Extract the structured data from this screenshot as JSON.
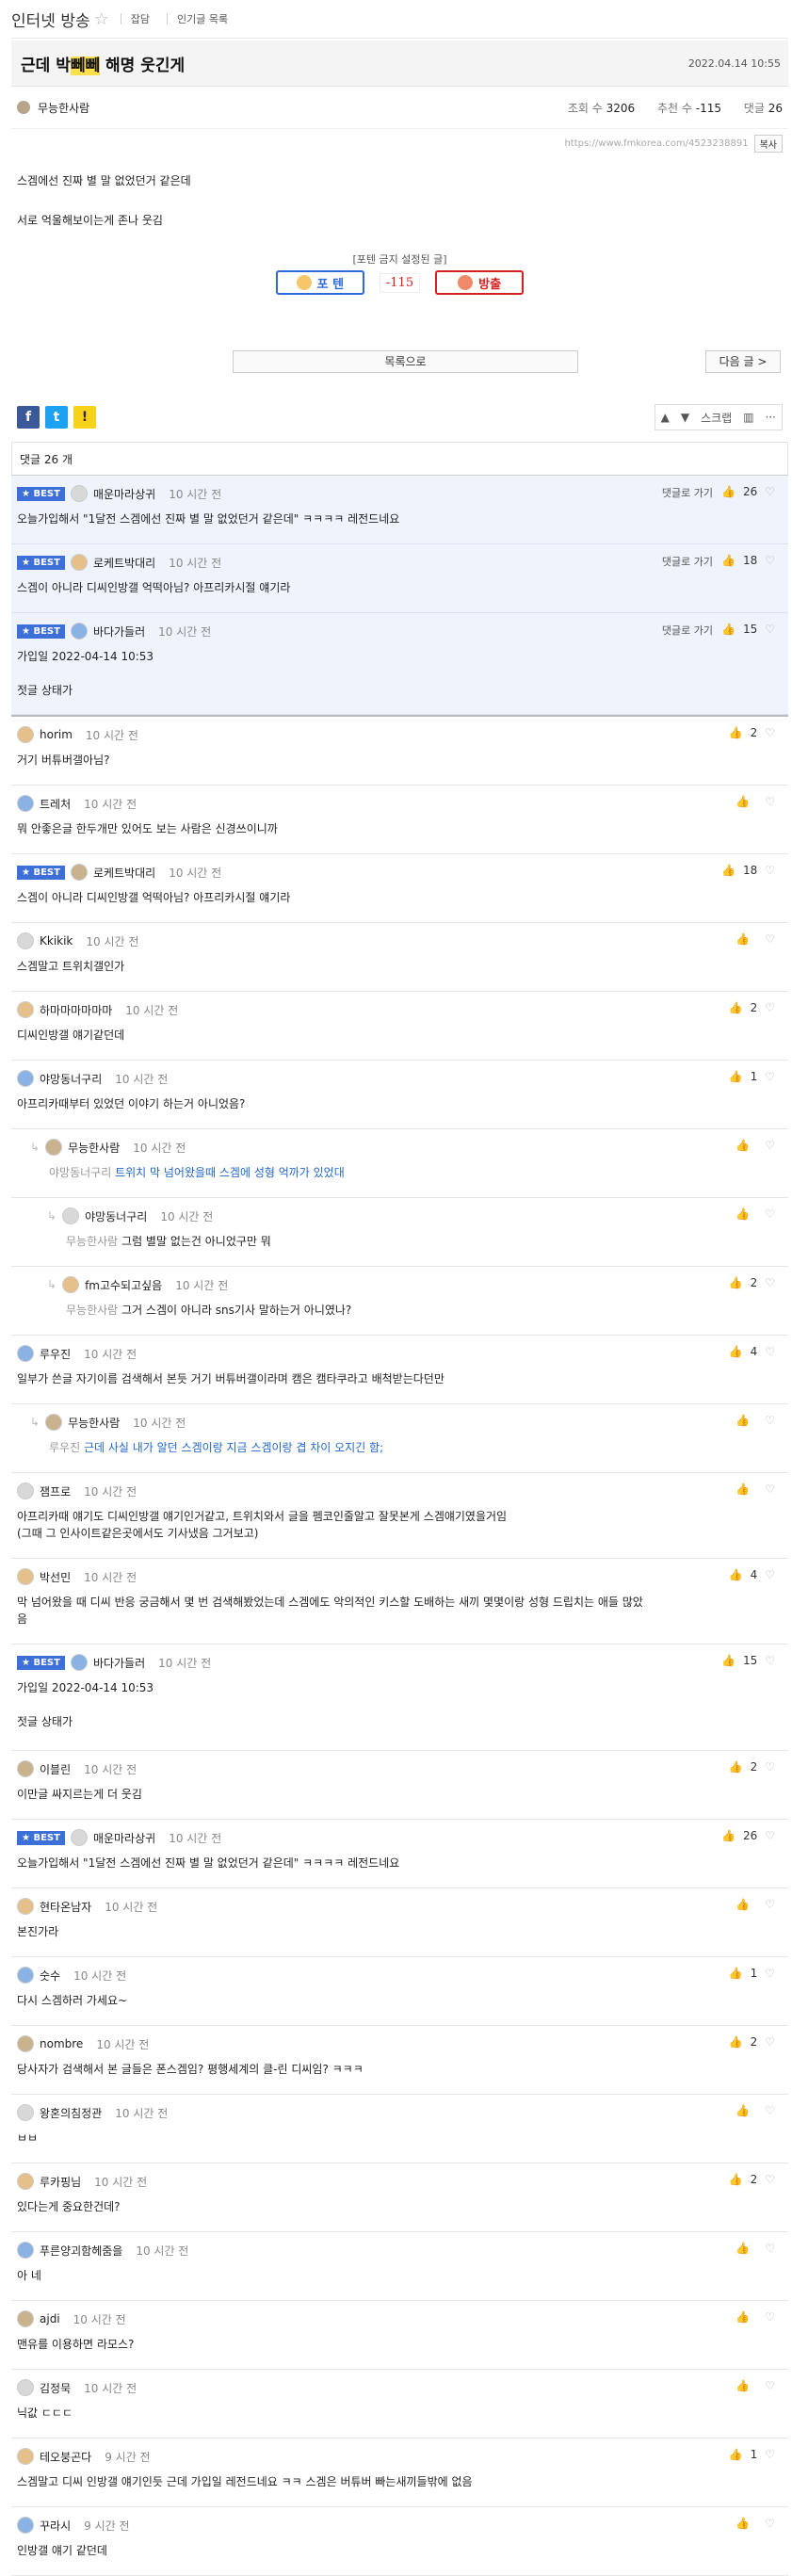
{
  "board": {
    "title": "인터넷 방송",
    "star": "☆",
    "links": [
      "잡담",
      "인기글 목록"
    ]
  },
  "post": {
    "title_prefix": "근데 박",
    "title_highlight": "뻬뻬",
    "title_suffix": " 해명 웃긴게",
    "date": "2022.04.14 10:55",
    "author": "무능한사람",
    "views_label": "조회 수",
    "views": "3206",
    "votes_label": "추천 수",
    "votes": "-115",
    "comments_label": "댓글",
    "comments": "26",
    "url": "https://www.fmkorea.com/4523238891",
    "copy": "복사",
    "body": [
      "스겜에선 진짜 별 말 없었던거 같은데",
      "서로 억울해보이는게 존나 웃김"
    ],
    "vote_caption": "[포텐 금지 설정된 글]",
    "vote_up": "포 텐",
    "vote_count": "-115",
    "vote_down": "방출",
    "list_btn": "목록으로",
    "next_btn": "다음 글 >",
    "share": {
      "fb": "f",
      "tw": "t",
      "kk": "!"
    },
    "tools": {
      "up": "▲",
      "down": "▼",
      "scrap": "스크랩",
      "stat": "▥",
      "more": "···"
    },
    "comment_count": "댓글 26 개"
  },
  "best_comments": [
    {
      "badge": "★ BEST",
      "nick": "매운마라상귀",
      "ago": "10 시간 전",
      "goto": "댓글로 가기",
      "likes": "26",
      "text": "오늘가입해서 \"1달전 스겜에선 진짜 별 말 없었던거 같은데\" ㅋㅋㅋㅋ 레전드네요"
    },
    {
      "badge": "★ BEST",
      "nick": "로케트박대리",
      "ago": "10 시간 전",
      "goto": "댓글로 가기",
      "likes": "18",
      "text": "스겜이 아니라 디씨인방갤 억떡아님? 아프리카시절 얘기라"
    },
    {
      "badge": "★ BEST",
      "nick": "바다가들러",
      "ago": "10 시간 전",
      "goto": "댓글로 가기",
      "likes": "15",
      "text": "가입일 2022-04-14 10:53",
      "text2": "젓글 상태가"
    }
  ],
  "comments": [
    {
      "nick": "horim",
      "ago": "10 시간 전",
      "likes": "2",
      "text": "거기 버튜버갤아님?"
    },
    {
      "nick": "트레처",
      "ago": "10 시간 전",
      "likes": "",
      "text": "뭐 안좋은글 한두개만 있어도 보는 사람은 신경쓰이니까"
    },
    {
      "badge": "★ BEST",
      "nick": "로케트박대리",
      "ago": "10 시간 전",
      "likes": "18",
      "text": "스겜이 아니라 디씨인방갤 억떡아님? 아프리카시절 얘기라"
    },
    {
      "nick": "Kkikik",
      "ago": "10 시간 전",
      "likes": "",
      "text": "스겜말고 트위치갤인가"
    },
    {
      "nick": "하마마마마마마",
      "ago": "10 시간 전",
      "likes": "2",
      "text": "디씨인방갤 얘기같던데"
    },
    {
      "nick": "야망동너구리",
      "ago": "10 시간 전",
      "likes": "1",
      "text": "아프리카때부터 있었던 이야기 하는거 아니었음?"
    },
    {
      "reply": true,
      "level": 1,
      "nick": "무능한사람",
      "ago": "10 시간 전",
      "likes": "",
      "quote": "야망동너구리",
      "text": "트위치 막 넘어왔을때 스겜에 성형 억까가 있었대",
      "blue": true
    },
    {
      "reply": true,
      "level": 2,
      "nick": "야망동너구리",
      "ago": "10 시간 전",
      "likes": "",
      "quote": "무능한사람",
      "text": "그럼 별말 없는건 아니었구만 뭐"
    },
    {
      "reply": true,
      "level": 2,
      "nick": "fm고수되고싶음",
      "ago": "10 시간 전",
      "likes": "2",
      "quote": "무능한사람",
      "text": "그거 스겜이 아니라 sns기사 말하는거 아니였나?"
    },
    {
      "nick": "루우진",
      "ago": "10 시간 전",
      "likes": "4",
      "text": "일부가 쓴글 자기이름 검색해서 본듯 거기 버튜버갤이라며 캠은 캠타쿠라고 배척받는다던만"
    },
    {
      "reply": true,
      "level": 1,
      "nick": "무능한사람",
      "ago": "10 시간 전",
      "likes": "",
      "quote": "루우진",
      "text": "근데 사실 내가 알던 스겜이랑 지금 스겜이랑 겹 차이 오지긴 함;",
      "blue": true
    },
    {
      "nick": "잼프로",
      "ago": "10 시간 전",
      "likes": "",
      "text": "아프리카때 얘기도 디씨인방갤 얘기인거같고, 트위치와서 글을 펨코인줄알고 잘못본게 스겜얘기였을거임",
      "text2": "(그때 그 인사이트같은곳에서도 기사냈음 그거보고)"
    },
    {
      "nick": "박선민",
      "ago": "10 시간 전",
      "likes": "4",
      "text": "막 넘어왔을 때 디씨 반응 궁금해서 몇 번 검색해봤었는데 스겜에도 악의적인 키스할 도배하는 새끼 몇몇이랑 성형 드립치는 애들 많았",
      "text2": "음"
    },
    {
      "badge": "★ BEST",
      "nick": "바다가들러",
      "ago": "10 시간 전",
      "likes": "15",
      "text": "가입일 2022-04-14 10:53",
      "text3": "젓글 상태가"
    },
    {
      "nick": "이블린",
      "ago": "10 시간 전",
      "likes": "2",
      "text": "이만글 싸지르는게 더 웃김"
    },
    {
      "badge": "★ BEST",
      "nick": "매운마라상귀",
      "ago": "10 시간 전",
      "likes": "26",
      "text": "오늘가입해서 \"1달전 스겜에선 진짜 별 말 없었던거 같은데\" ㅋㅋㅋㅋ 레전드네요"
    },
    {
      "nick": "현타온남자",
      "ago": "10 시간 전",
      "likes": "",
      "text": "본진가라"
    },
    {
      "nick": "숫수",
      "ago": "10 시간 전",
      "likes": "1",
      "text": "다시 스겜하러 가세요~"
    },
    {
      "nick": "nombre",
      "ago": "10 시간 전",
      "likes": "2",
      "text": "당사자가 검색해서 본 글들은 폰스겜임? 평행세계의 클-린 디씨임? ㅋㅋㅋ"
    },
    {
      "nick": "왕혼의침정관",
      "ago": "10 시간 전",
      "likes": "",
      "text": "ㅂㅂ"
    },
    {
      "nick": "루카핑님",
      "ago": "10 시간 전",
      "likes": "2",
      "text": "있다는게 중요한건데?"
    },
    {
      "nick": "푸른양괴함헤줌을",
      "ago": "10 시간 전",
      "likes": "",
      "text": "아 네"
    },
    {
      "nick": "ajdi",
      "ago": "10 시간 전",
      "likes": "",
      "text": "맨유를 이용하면 라모스?"
    },
    {
      "nick": "김정묵",
      "ago": "10 시간 전",
      "likes": "",
      "text": "닉값 ㄷㄷㄷ"
    },
    {
      "nick": "테오붕곤다",
      "ago": "9 시간 전",
      "likes": "1",
      "text": "스겜말고 디씨 인방갤 얘기인듯 근데 가입일 레전드네요 ㅋㅋ 스겜은 버튜버 빠는새끼들밖에 없음"
    },
    {
      "nick": "꾸라시",
      "ago": "9 시간 전",
      "likes": "",
      "text": "인방갤 얘기 같던데"
    }
  ]
}
